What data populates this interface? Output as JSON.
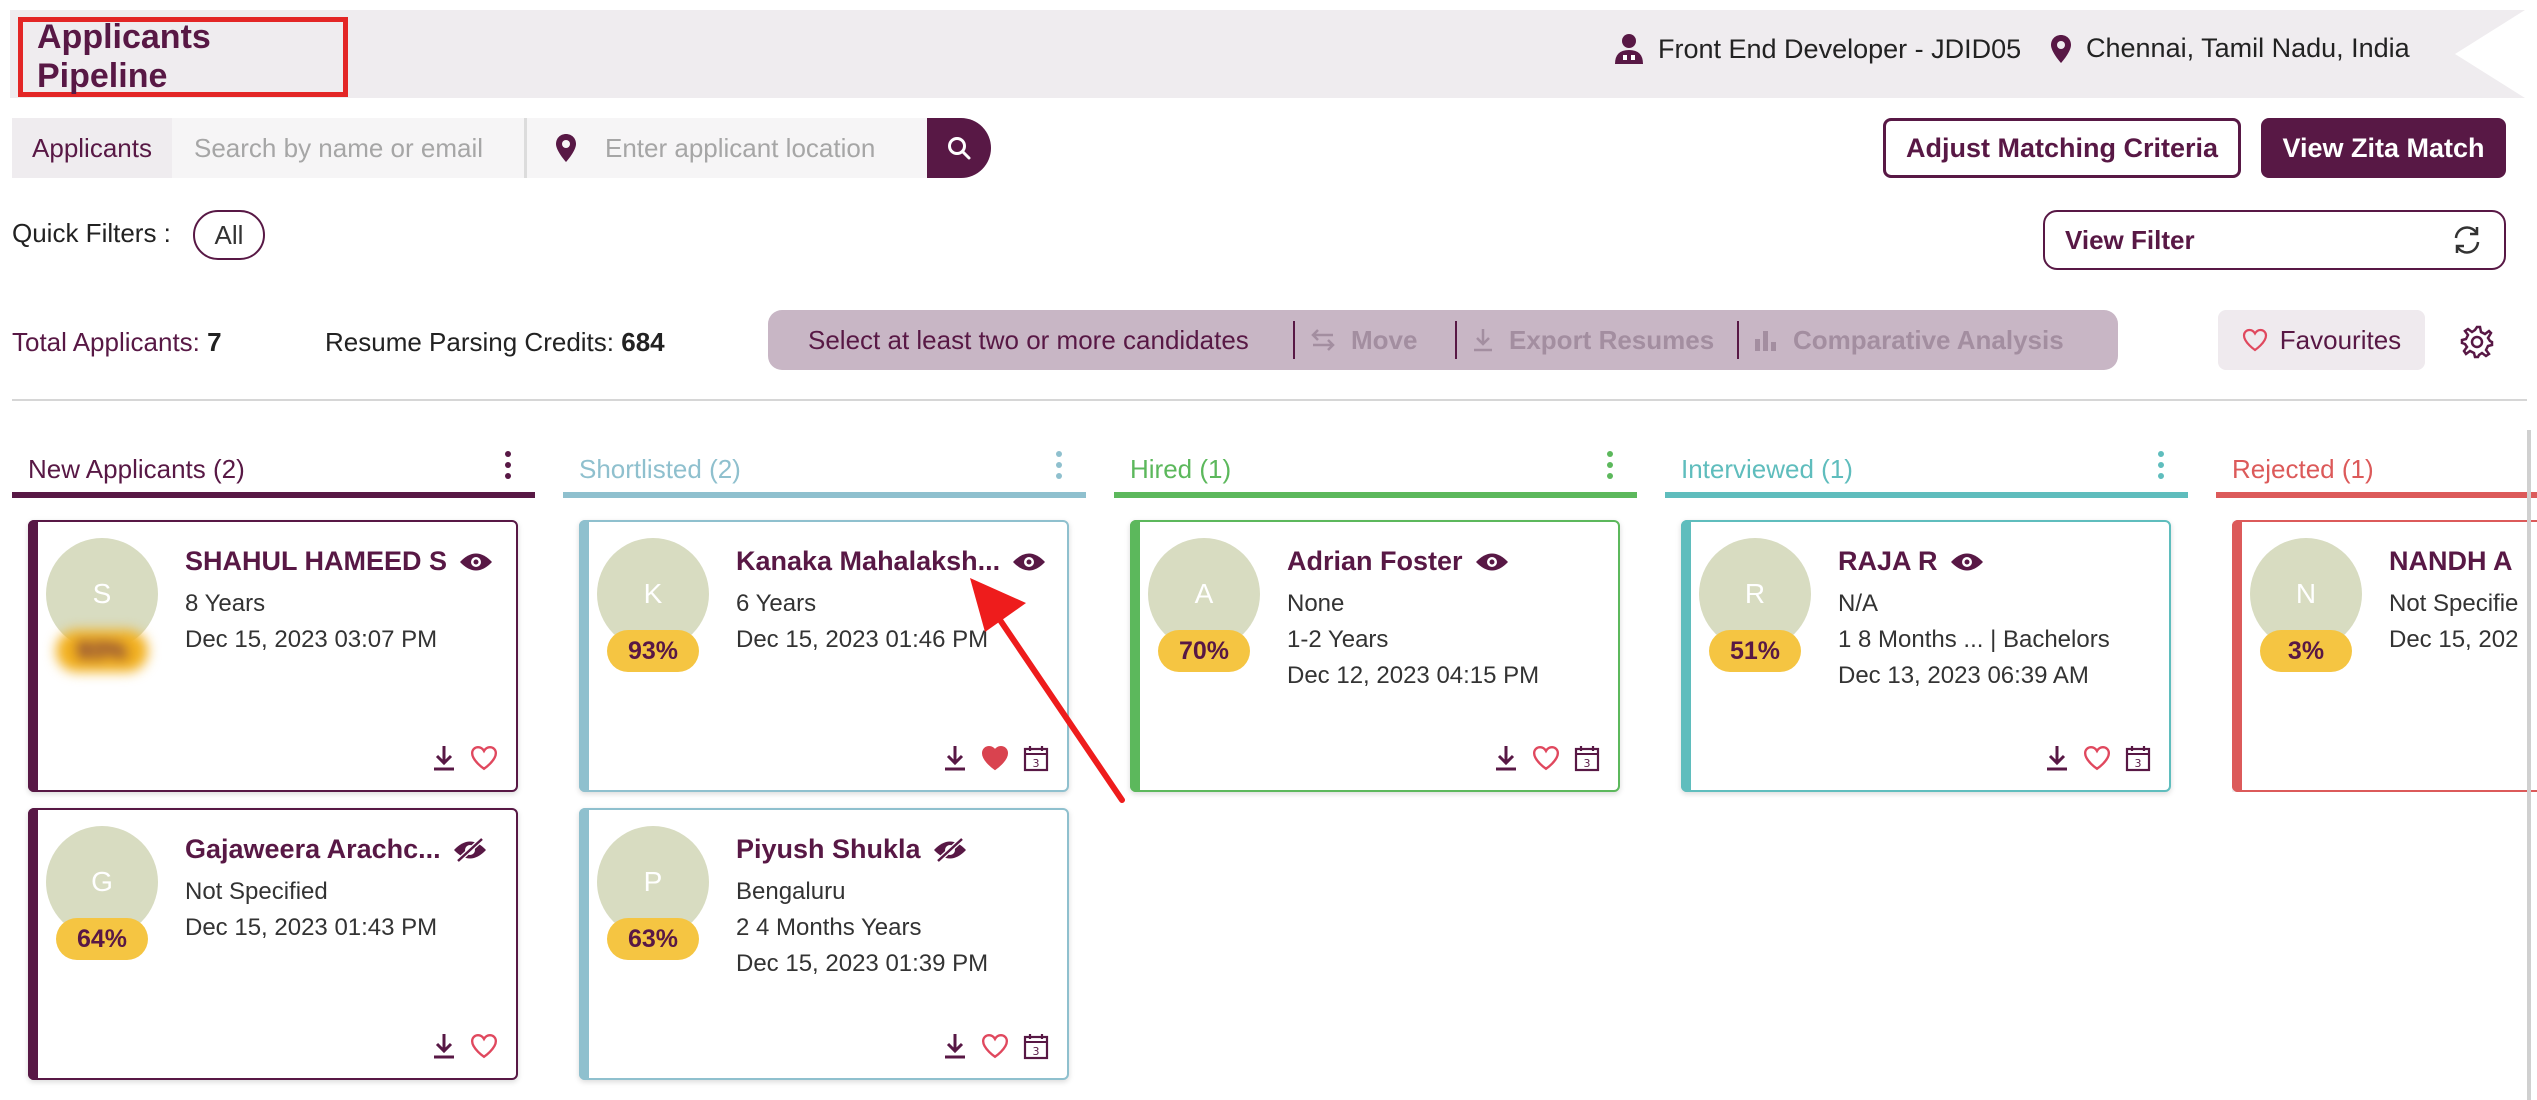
{
  "header": {
    "title": "Applicants Pipeline",
    "job": "Front End Developer - JDID05",
    "location": "Chennai, Tamil Nadu, India"
  },
  "search": {
    "tab_label": "Applicants",
    "name_placeholder": "Search by name or email",
    "location_placeholder": "Enter applicant location"
  },
  "buttons": {
    "adjust": "Adjust Matching Criteria",
    "zita": "View Zita Match",
    "view_filter": "View Filter",
    "favourites": "Favourites"
  },
  "quick_filters": {
    "label": "Quick Filters :",
    "all": "All"
  },
  "stats": {
    "total_label": "Total Applicants:",
    "total_value": "7",
    "credits_label": "Resume Parsing Credits:",
    "credits_value": "684"
  },
  "action_bar": {
    "hint": "Select at least two or more candidates",
    "move": "Move",
    "export": "Export Resumes",
    "compare": "Comparative Analysis"
  },
  "colors": {
    "brand": "#581845",
    "new": "#581845",
    "shortlisted": "#8fc0ce",
    "hired": "#5cb85c",
    "interviewed": "#5fbdbd",
    "rejected": "#dc5a5a",
    "score": "#f5c542"
  },
  "columns": [
    {
      "label": "New Applicants (2)"
    },
    {
      "label": "Shortlisted (2)"
    },
    {
      "label": "Hired (1)"
    },
    {
      "label": "Interviewed (1)"
    },
    {
      "label": "Rejected (1)"
    }
  ],
  "cards": [
    {
      "initial": "S",
      "name": "SHAHUL HAMEED S",
      "score": "",
      "lines": [
        "8 Years",
        "Dec 15, 2023 03:07 PM"
      ],
      "icon": "eye-icon"
    },
    {
      "initial": "G",
      "name": "Gajaweera Arachc...",
      "score": "64%",
      "lines": [
        "Not Specified",
        "Dec 15, 2023 01:43 PM"
      ],
      "icon": "eye-off-icon"
    },
    {
      "initial": "K",
      "name": "Kanaka Mahalaksh...",
      "score": "93%",
      "lines": [
        "6 Years",
        "Dec 15, 2023 01:46 PM"
      ],
      "icon": "eye-icon"
    },
    {
      "initial": "P",
      "name": "Piyush Shukla",
      "score": "63%",
      "lines": [
        "Bengaluru",
        "2 4 Months Years",
        "Dec 15, 2023 01:39 PM"
      ],
      "icon": "eye-off-icon"
    },
    {
      "initial": "A",
      "name": "Adrian Foster",
      "score": "70%",
      "lines": [
        "None",
        "1-2 Years",
        "Dec 12, 2023 04:15 PM"
      ],
      "icon": "eye-icon"
    },
    {
      "initial": "R",
      "name": "RAJA R",
      "score": "51%",
      "lines": [
        "N/A",
        "1 8 Months ... | Bachelors",
        "Dec 13, 2023 06:39 AM"
      ],
      "icon": "eye-icon"
    },
    {
      "initial": "N",
      "name": "NANDH A",
      "score": "3%",
      "lines": [
        "Not Specifie",
        "Dec 15, 202"
      ],
      "icon": "eye-icon"
    }
  ]
}
